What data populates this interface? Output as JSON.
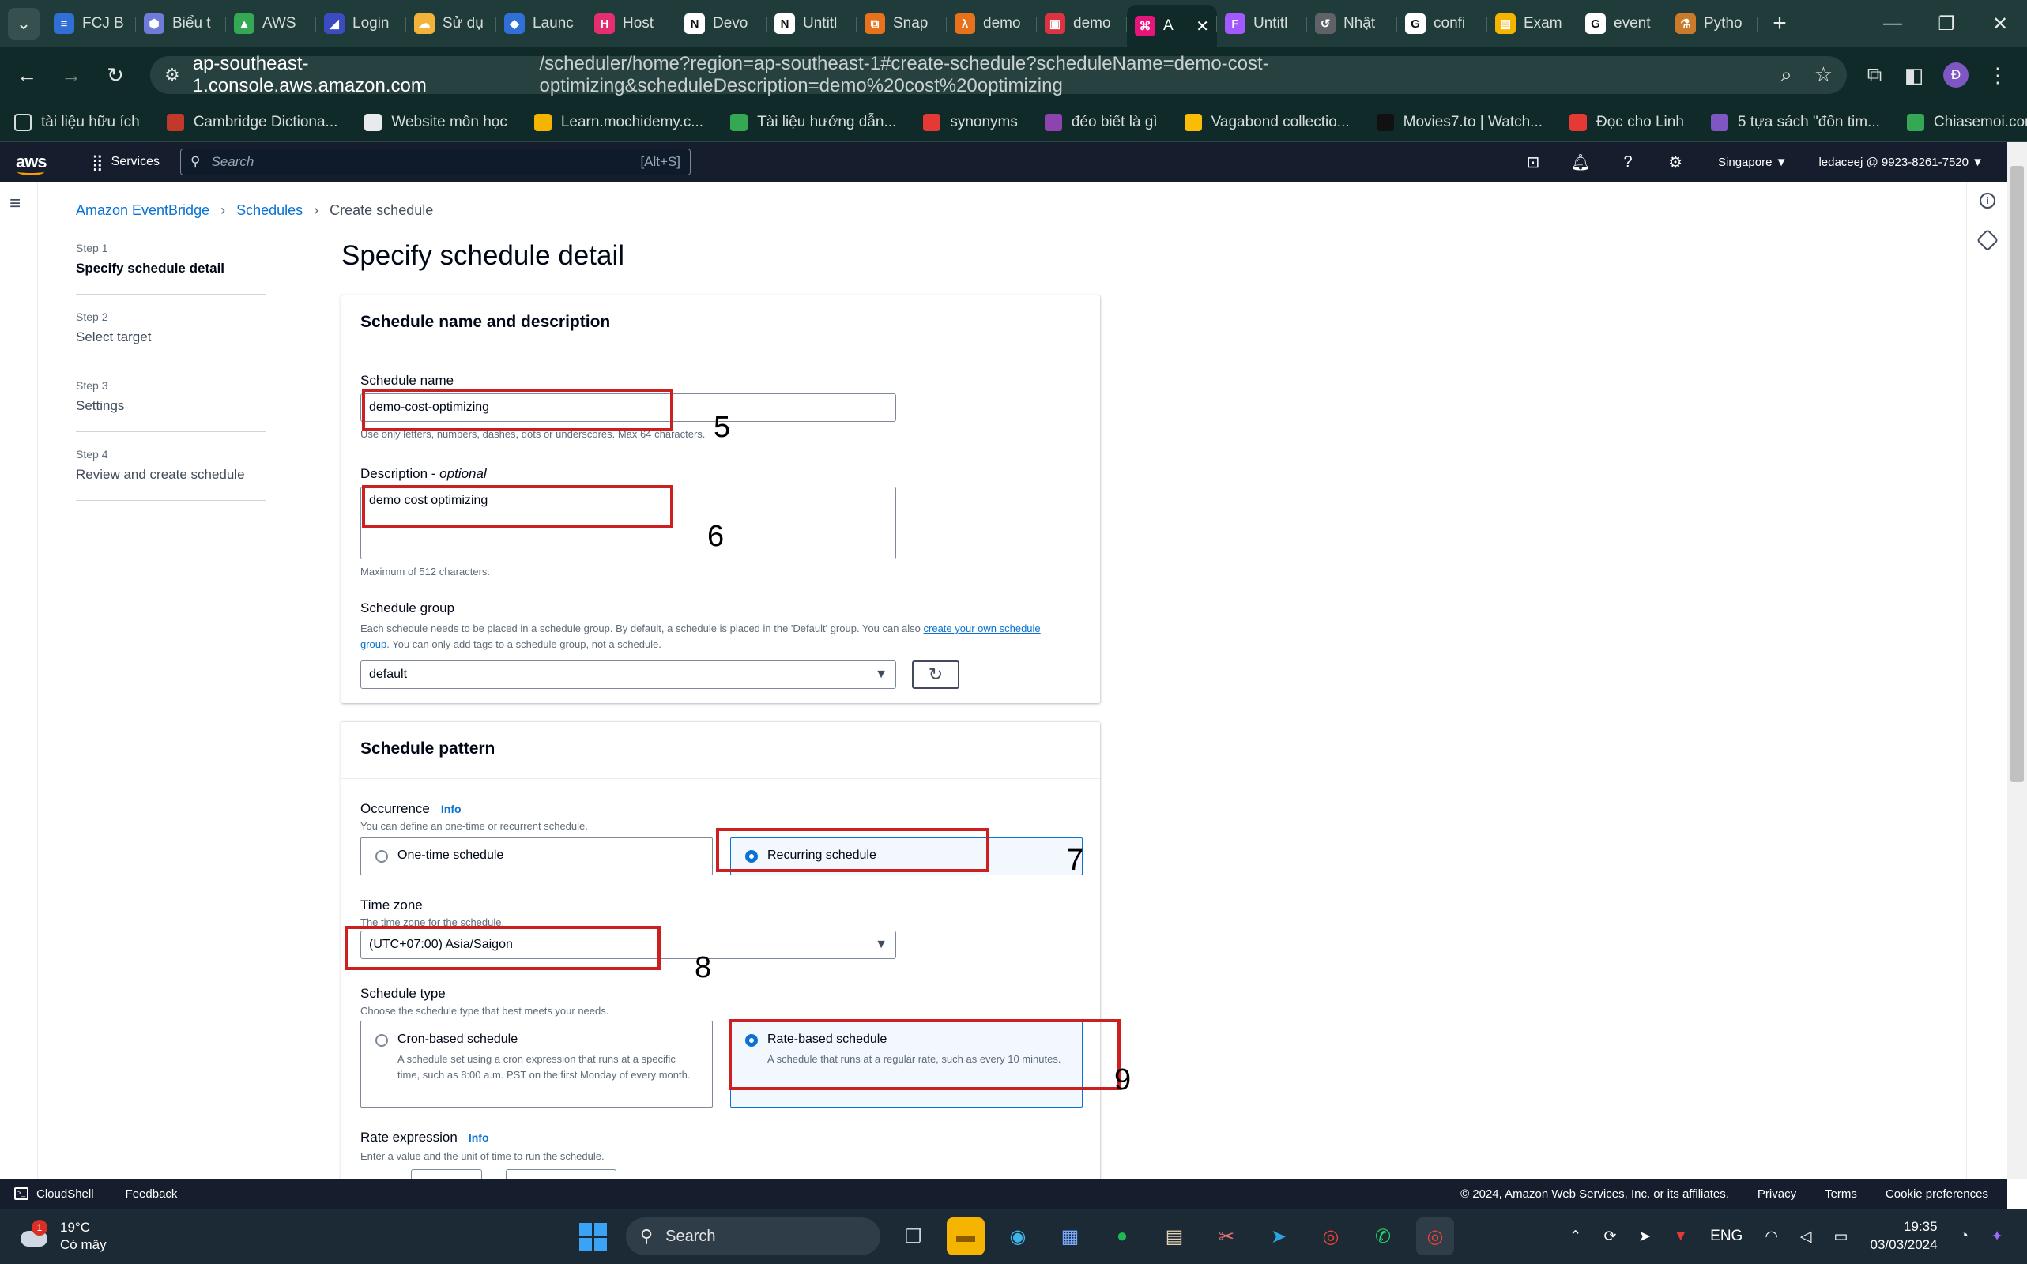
{
  "browser": {
    "tabs": [
      {
        "title": "FCJ B",
        "color": "#2f6fd6",
        "glyph": "≡"
      },
      {
        "title": "Biểu t",
        "color": "#6f7bd9",
        "glyph": "⬢"
      },
      {
        "title": "AWS",
        "color": "#34a853",
        "glyph": "▲"
      },
      {
        "title": "Login",
        "color": "#3b4cc0",
        "glyph": "◢"
      },
      {
        "title": "Sử dụ",
        "color": "#f3b23a",
        "glyph": "☁"
      },
      {
        "title": "Launc",
        "color": "#2f6fd6",
        "glyph": "◆"
      },
      {
        "title": "Host",
        "color": "#e52e71",
        "glyph": "H"
      },
      {
        "title": "Devo",
        "color": "#ffffff",
        "glyph": "N"
      },
      {
        "title": "Untitl",
        "color": "#ffffff",
        "glyph": "N"
      },
      {
        "title": "Snap",
        "color": "#e8711c",
        "glyph": "⧉"
      },
      {
        "title": "demo",
        "color": "#e8711c",
        "glyph": "λ"
      },
      {
        "title": "demo",
        "color": "#dd3340",
        "glyph": "▣"
      },
      {
        "title": "A",
        "color": "#e7157b",
        "glyph": "⌘",
        "active": true
      },
      {
        "title": "Untitl",
        "color": "#a259ff",
        "glyph": "F"
      },
      {
        "title": "Nhật",
        "color": "#5f6368",
        "glyph": "↺"
      },
      {
        "title": "confi",
        "color": "#ffffff",
        "glyph": "G"
      },
      {
        "title": "Exam",
        "color": "#f4b400",
        "glyph": "▤"
      },
      {
        "title": "event",
        "color": "#ffffff",
        "glyph": "G"
      },
      {
        "title": "Pytho",
        "color": "#c97a2b",
        "glyph": "⚗"
      }
    ],
    "url_host": "ap-southeast-1.console.aws.amazon.com",
    "url_rest": "/scheduler/home?region=ap-southeast-1#create-schedule?scheduleName=demo-cost-optimizing&scheduleDescription=demo%20cost%20optimizing",
    "profile_initial": "Đ",
    "bookmarks": [
      {
        "label": "tài liệu hữu ích",
        "color": "#d8dede"
      },
      {
        "label": "Cambridge Dictiona...",
        "color": "#c0392b"
      },
      {
        "label": "Website môn học",
        "color": "#e8eaed"
      },
      {
        "label": "Learn.mochidemy.c...",
        "color": "#f4b400"
      },
      {
        "label": "Tài liệu hướng dẫn...",
        "color": "#34a853"
      },
      {
        "label": "synonyms",
        "color": "#e53935"
      },
      {
        "label": "đéo biết là gì",
        "color": "#8e44ad"
      },
      {
        "label": "Vagabond collectio...",
        "color": "#fbbc05"
      },
      {
        "label": "Movies7.to | Watch...",
        "color": "#111111"
      },
      {
        "label": "Đọc cho Linh",
        "color": "#e53935"
      },
      {
        "label": "5 tựa sách \"đốn tim...",
        "color": "#7e57c2"
      },
      {
        "label": "Chiasemoi.com_hie...",
        "color": "#34a853"
      }
    ],
    "bookmarks_more": "»"
  },
  "aws": {
    "logo": "aws",
    "services_label": "Services",
    "search_placeholder": "Search",
    "search_shortcut": "[Alt+S]",
    "region": "Singapore ▼",
    "account": "ledaceej @ 9923-8261-7520 ▼"
  },
  "breadcrumb": {
    "root": "Amazon EventBridge",
    "parent": "Schedules",
    "current": "Create schedule"
  },
  "steps": [
    {
      "num": "Step 1",
      "label": "Specify schedule detail",
      "current": true
    },
    {
      "num": "Step 2",
      "label": "Select target"
    },
    {
      "num": "Step 3",
      "label": "Settings"
    },
    {
      "num": "Step 4",
      "label": "Review and create schedule"
    }
  ],
  "page_title": "Specify schedule detail",
  "name_panel": {
    "heading": "Schedule name and description",
    "name_label": "Schedule name",
    "name_value": "demo-cost-optimizing",
    "name_hint": "Use only letters, numbers, dashes, dots or underscores. Max 64 characters.",
    "desc_label": "Description",
    "desc_optional": "optional",
    "desc_value": "demo cost optimizing",
    "desc_hint": "Maximum of 512 characters.",
    "group_label": "Schedule group",
    "group_hint_1": "Each schedule needs to be placed in a schedule group. By default, a schedule is placed in the 'Default' group. You can also ",
    "group_hint_link": "create your own schedule group",
    "group_hint_2": ". You can only add tags to a schedule group, not a schedule.",
    "group_value": "default"
  },
  "pattern_panel": {
    "heading": "Schedule pattern",
    "occurrence_label": "Occurrence",
    "info": "Info",
    "occurrence_hint": "You can define an one-time or recurrent schedule.",
    "one_time": "One-time schedule",
    "recurring": "Recurring schedule",
    "tz_label": "Time zone",
    "tz_hint": "The time zone for the schedule.",
    "tz_value": "(UTC+07:00) Asia/Saigon",
    "type_label": "Schedule type",
    "type_hint": "Choose the schedule type that best meets your needs.",
    "cron_title": "Cron-based schedule",
    "cron_desc": "A schedule set using a cron expression that runs at a specific time, such as 8:00 a.m. PST on the first Monday of every month.",
    "rate_title": "Rate-based schedule",
    "rate_desc": "A schedule that runs at a regular rate, such as every 10 minutes.",
    "rate_label": "Rate expression",
    "rate_hint": "Enter a value and the unit of time to run the schedule."
  },
  "annotations": [
    "5",
    "6",
    "7",
    "8",
    "9"
  ],
  "footer": {
    "cloudshell": "CloudShell",
    "feedback": "Feedback",
    "copyright": "© 2024, Amazon Web Services, Inc. or its affiliates.",
    "privacy": "Privacy",
    "terms": "Terms",
    "cookies": "Cookie preferences"
  },
  "taskbar": {
    "weather_temp": "19°C",
    "weather_desc": "Có mây",
    "weather_badge": "1",
    "search": "Search",
    "lang": "ENG",
    "time": "19:35",
    "date": "03/03/2024"
  }
}
